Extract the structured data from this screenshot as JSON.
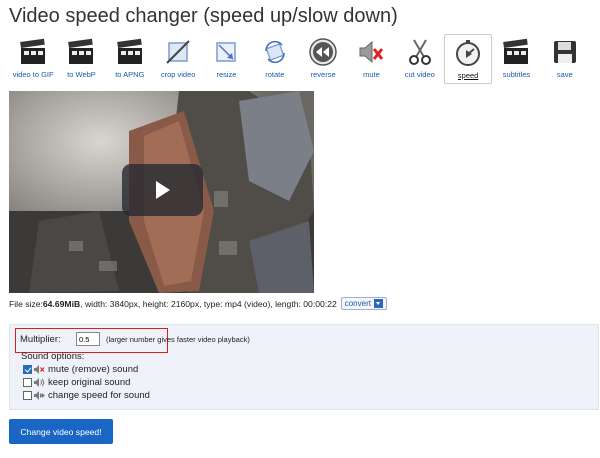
{
  "page": {
    "title": "Video speed changer (speed up/slow down)"
  },
  "toolbar": {
    "tools": [
      {
        "label": "video to GIF",
        "icon": "clapperboard-icon"
      },
      {
        "label": "to WebP",
        "icon": "clapperboard-icon"
      },
      {
        "label": "to APNG",
        "icon": "clapperboard-icon"
      },
      {
        "label": "crop video",
        "icon": "crop-icon"
      },
      {
        "label": "resize",
        "icon": "resize-icon"
      },
      {
        "label": "rotate",
        "icon": "rotate-icon"
      },
      {
        "label": "reverse",
        "icon": "rewind-icon"
      },
      {
        "label": "mute",
        "icon": "mute-icon"
      },
      {
        "label": "cut video",
        "icon": "scissors-icon"
      },
      {
        "label": "speed",
        "icon": "stopwatch-icon",
        "active": true
      },
      {
        "label": "subtitles",
        "icon": "clapperboard-icon"
      },
      {
        "label": "save",
        "icon": "floppy-disk-icon"
      }
    ]
  },
  "video": {
    "play_icon": "play-icon"
  },
  "fileinfo": {
    "prefix": "File size: ",
    "size": "64.69MiB",
    "details": ", width: 3840px, height: 2160px, type: mp4 (video), length: 00:00:22",
    "convert_label": "convert",
    "convert_icon": "download-icon"
  },
  "options": {
    "multiplier_label": "Multiplier:",
    "multiplier_value": "0.5",
    "multiplier_hint": "(larger number gives faster video playback)",
    "sound_header": "Sound options:",
    "sound_options": [
      {
        "label": "mute (remove) sound",
        "checked": true,
        "icon": "speaker-mute-icon"
      },
      {
        "label": "keep original sound",
        "checked": false,
        "icon": "speaker-icon"
      },
      {
        "label": "change speed for sound",
        "checked": false,
        "icon": "speaker-speed-icon"
      }
    ]
  },
  "submit": {
    "label": "Change video speed!"
  },
  "colors": {
    "accent": "#1a66c4",
    "link": "#1a5ca8",
    "highlight_box": "#d6201c",
    "options_bg": "#eef2f8"
  }
}
